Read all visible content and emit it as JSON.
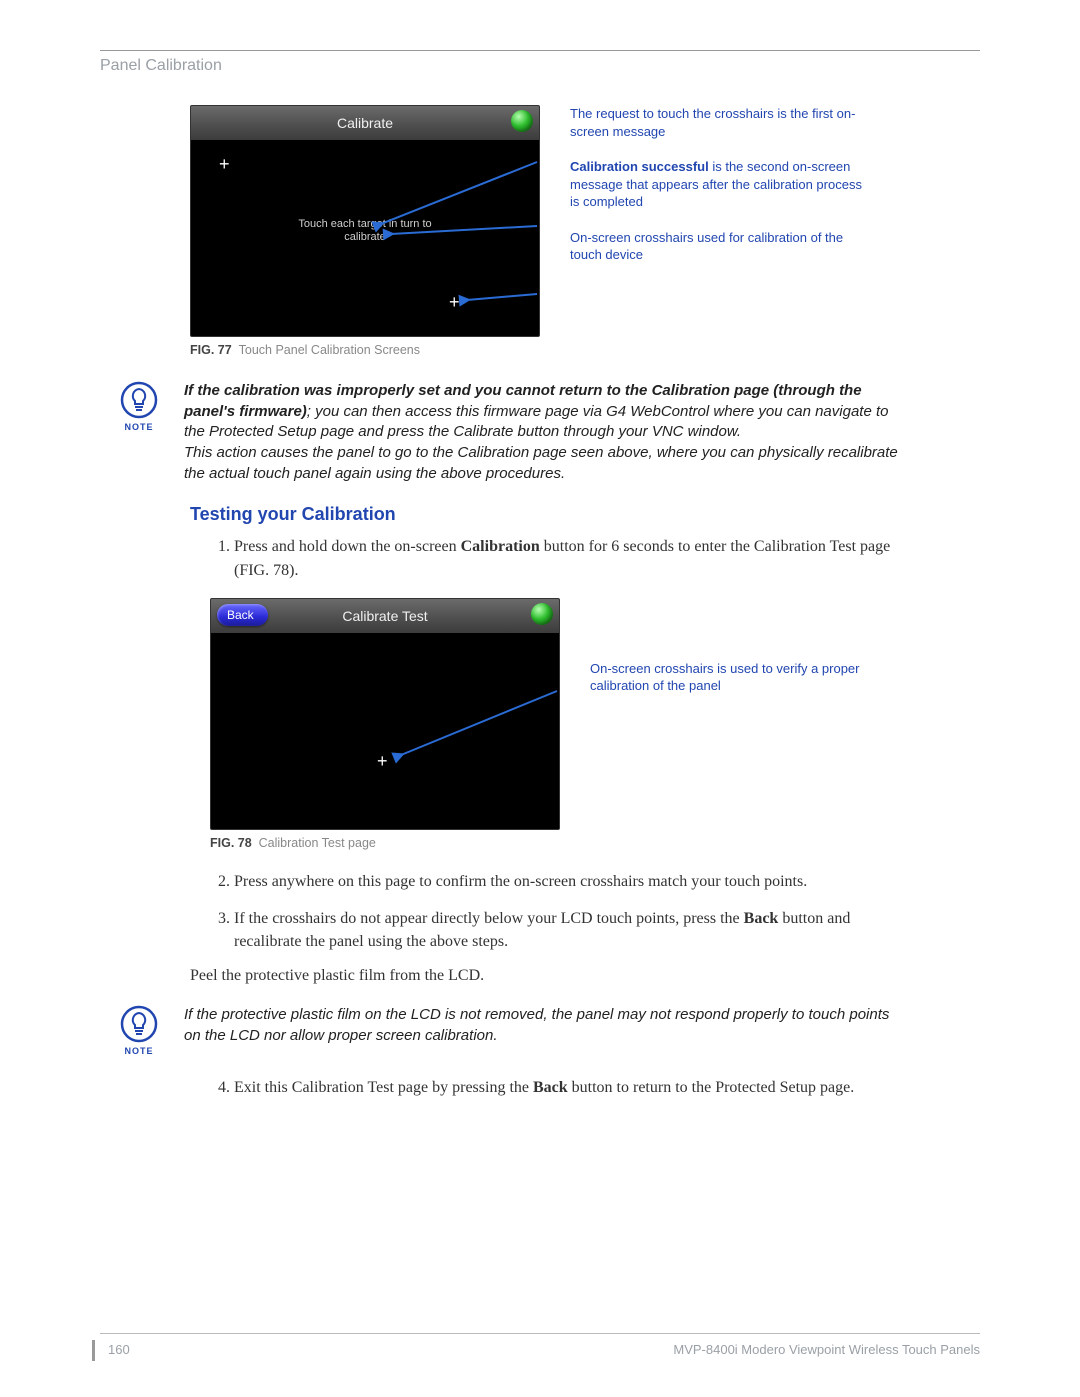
{
  "header": {
    "section": "Panel Calibration"
  },
  "fig77": {
    "screen_title": "Calibrate",
    "message": "Touch each target in turn to calibrate",
    "callout1": "The request to touch the crosshairs is the first on-screen message",
    "callout2_bold": "Calibration successful",
    "callout2_rest": " is the second on-screen message that appears after the calibration process is completed",
    "callout3": "On-screen crosshairs used for calibration of the touch device",
    "caption_num": "FIG. 77",
    "caption_text": "Touch Panel Calibration Screens"
  },
  "note1": {
    "line_bold": "If the calibration was improperly set and you cannot return to the Calibration page (through the panel's firmware)",
    "line_rest": "; you can then access this firmware page via G4 WebControl where you can navigate to the Protected Setup page and press the Calibrate button through your VNC window.",
    "line2": "This action causes the panel to go to the Calibration page seen above, where you can physically recalibrate the actual touch panel again using the above procedures."
  },
  "heading": "Testing your Calibration",
  "steps": {
    "s1_a": "Press and hold down the on-screen ",
    "s1_bold": "Calibration",
    "s1_b": " button for 6 seconds to enter the Calibration Test page (FIG. 78).",
    "s2": "Press anywhere on this page to confirm the on-screen crosshairs match your touch points.",
    "s3_a": "If the crosshairs do not appear directly below your LCD touch points, press the ",
    "s3_bold": "Back",
    "s3_b": " button and recalibrate the panel using the above steps.",
    "s4_a": "Exit this Calibration Test page by pressing the ",
    "s4_bold": "Back",
    "s4_b": " button to return to the Protected Setup page."
  },
  "fig78": {
    "back_label": "Back",
    "screen_title": "Calibrate Test",
    "callout1": "On-screen crosshairs is used to verify a proper calibration of the panel",
    "caption_num": "FIG. 78",
    "caption_text": "Calibration Test page"
  },
  "after_list": "Peel the protective plastic film from the LCD.",
  "note2": {
    "text": "If the protective plastic film on the LCD is not removed, the panel may not respond properly to touch points on the LCD nor allow proper screen calibration."
  },
  "footer": {
    "page": "160",
    "doc": "MVP-8400i Modero Viewpoint Wireless Touch Panels"
  },
  "icons": {
    "note_label": "NOTE"
  }
}
